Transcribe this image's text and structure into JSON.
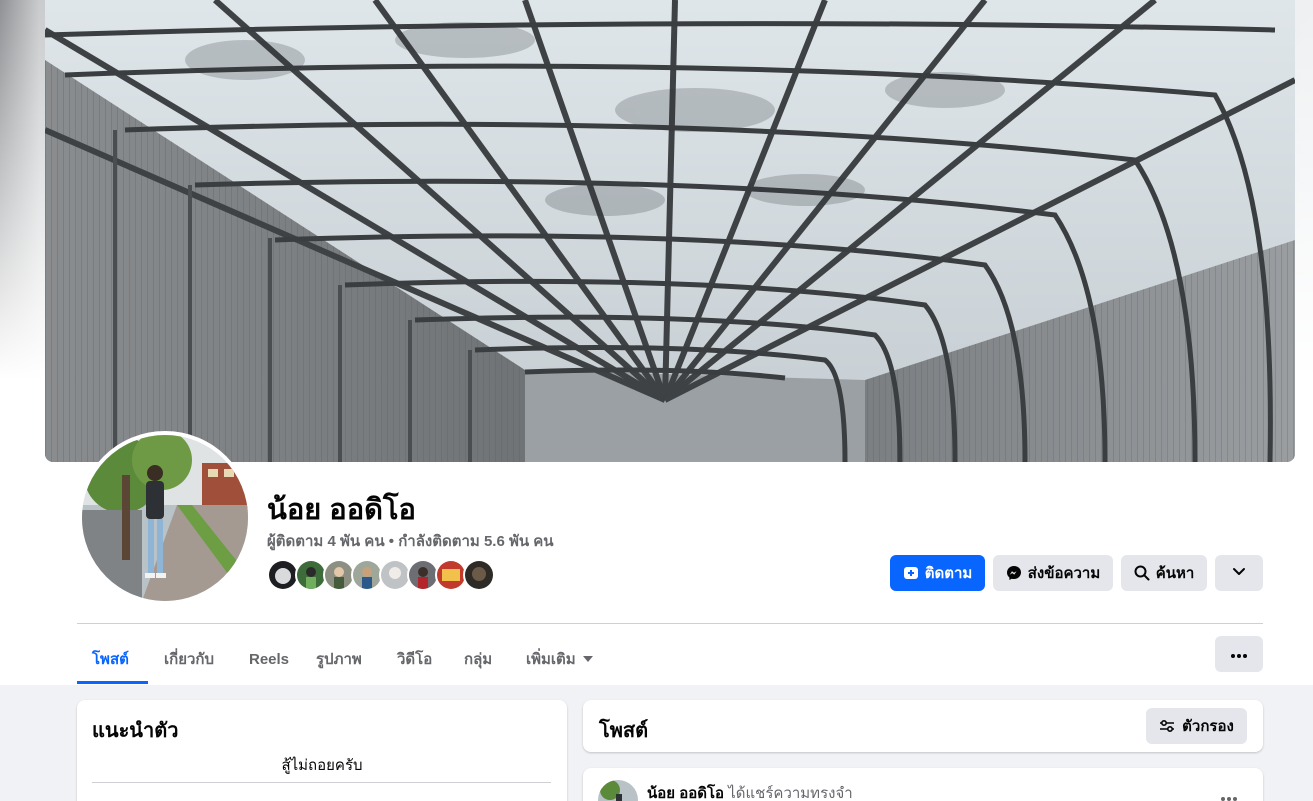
{
  "profile": {
    "name": "น้อย ออดิโอ",
    "followers_label": "ผู้ติดตาม 4 พัน คน",
    "separator": "•",
    "following_label": "กำลังติดตาม 5.6 พัน คน"
  },
  "actions": {
    "follow": "ติดตาม",
    "message": "ส่งข้อความ",
    "search": "ค้นหา"
  },
  "tabs": [
    "โพสต์",
    "เกี่ยวกับ",
    "Reels",
    "รูปภาพ",
    "วิดีโอ",
    "กลุ่ม",
    "เพิ่มเติม"
  ],
  "intro": {
    "title": "แนะนำตัว",
    "bio": "สู้ไม่ถอยครับ"
  },
  "posts": {
    "title": "โพสต์",
    "filter_label": "ตัวกรอง",
    "first_post": {
      "author": "น้อย ออดิโอ",
      "action": "ได้แชร์ความทรงจำ"
    }
  },
  "colors": {
    "accent": "#0866ff",
    "secondary_button": "#e4e6eb",
    "muted_text": "#65676b",
    "page_background": "#f0f2f5"
  },
  "icons": {
    "follow": "user-add-icon",
    "message": "messenger-icon",
    "search": "search-icon",
    "dropdown": "chevron-down-icon",
    "more": "more-dots-icon",
    "filter": "filter-sliders-icon"
  }
}
